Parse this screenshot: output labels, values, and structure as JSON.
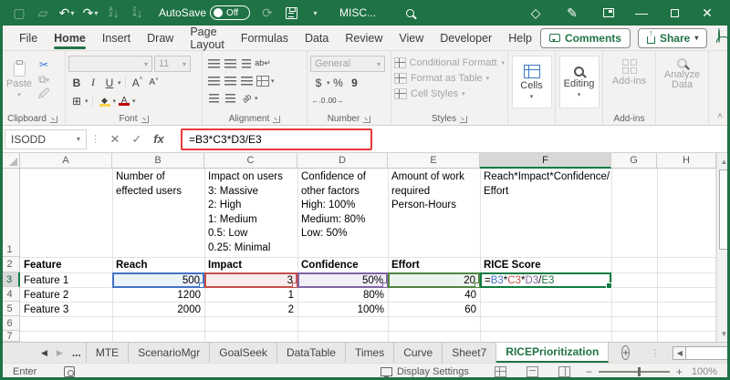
{
  "window": {
    "autosave_label": "AutoSave",
    "autosave_state": "Off",
    "filename": "MISC..."
  },
  "colors": {
    "titlebar_green": "#1F7244",
    "excel_green": "#217346",
    "edit_border_green": "#107C41",
    "annotation_red": "#E83A3A",
    "ref_blue": "#4472C4",
    "ref_red": "#C5504B",
    "ref_purple": "#8064A2",
    "ref_green": "#4E8542"
  },
  "ribbon_tabs": {
    "file": "File",
    "home": "Home",
    "insert": "Insert",
    "draw": "Draw",
    "page_layout": "Page Layout",
    "formulas": "Formulas",
    "data": "Data",
    "review": "Review",
    "view": "View",
    "developer": "Developer",
    "help": "Help",
    "comments": "Comments",
    "share": "Share"
  },
  "ribbon": {
    "paste": "Paste",
    "clipboard_group": "Clipboard",
    "bold": "B",
    "italic": "I",
    "underline": "U",
    "font_size": "11",
    "font_group": "Font",
    "alignment_group": "Alignment",
    "number_format": "General",
    "currency": "$",
    "percent": "%",
    "comma": "9",
    "number_group": "Number",
    "conditional_formatting": "Conditional Formatting",
    "format_as_table": "Format as Table",
    "cell_styles": "Cell Styles",
    "styles_group": "Styles",
    "cells": "Cells",
    "editing": "Editing",
    "addins": "Add-ins",
    "addins_group": "Add-ins",
    "analyze_data": "Analyze Data"
  },
  "formula_bar": {
    "name_box": "ISODD",
    "fx": "fx",
    "formula": "=B3*C3*D3/E3"
  },
  "grid": {
    "col_headers": [
      "A",
      "B",
      "C",
      "D",
      "E",
      "F",
      "G",
      "H"
    ],
    "row_numbers": [
      "1",
      "2",
      "3",
      "4",
      "5",
      "6",
      "7"
    ],
    "r1": {
      "b": "Number of\neffected users",
      "c": "Impact on users\n3: Massive\n2: High\n1: Medium\n0.5: Low\n0.25: Minimal",
      "d": "Confidence of\nother factors\nHigh: 100%\nMedium: 80%\nLow: 50%",
      "e": "Amount of work\nrequired\nPerson-Hours",
      "f": "Reach*Impact*Confidence/\nEffort"
    },
    "r2": {
      "a": "Feature",
      "b": "Reach",
      "c": "Impact",
      "d": "Confidence",
      "e": "Effort",
      "f": "RICE Score"
    },
    "r3": {
      "a": "Feature 1",
      "b": "500",
      "c": "3",
      "d": "50%",
      "e": "20"
    },
    "r4": {
      "a": "Feature 2",
      "b": "1200",
      "c": "1",
      "d": "80%",
      "e": "40"
    },
    "r5": {
      "a": "Feature 3",
      "b": "2000",
      "c": "2",
      "d": "100%",
      "e": "60"
    },
    "f3_tokens": [
      "=",
      "B3",
      "*",
      "C3",
      "*",
      "D3",
      "/",
      "E3"
    ]
  },
  "sheet_bar": {
    "overflow": "...",
    "tabs": [
      "MTE",
      "ScenarioMgr",
      "GoalSeek",
      "DataTable",
      "Times",
      "Curve",
      "Sheet7"
    ],
    "active_tab": "RICEPrioritization"
  },
  "status_bar": {
    "mode": "Enter",
    "display_settings": "Display Settings",
    "zoom_level": "100%"
  }
}
